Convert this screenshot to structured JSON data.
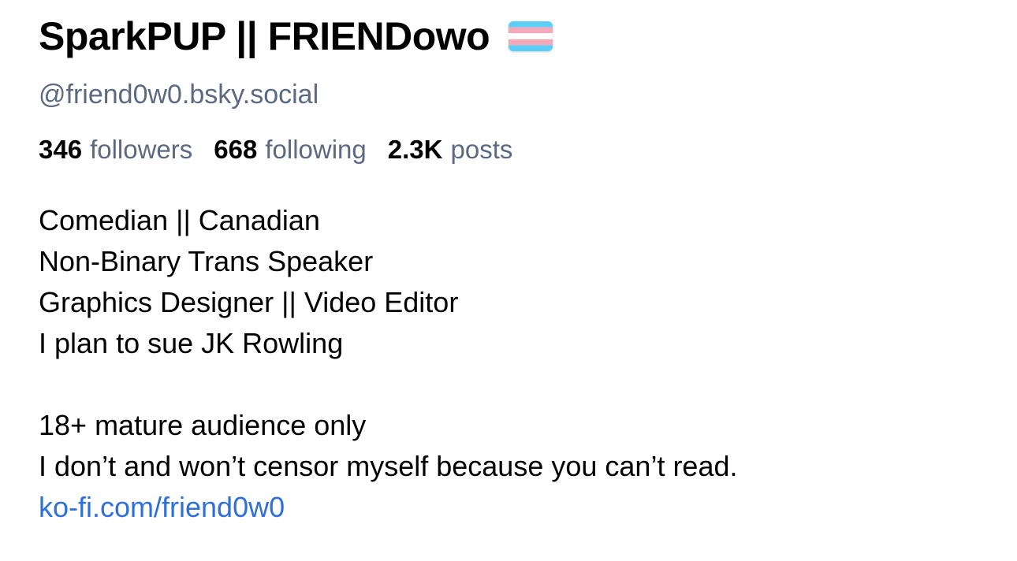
{
  "profile": {
    "display_name": "SparkPUP || FRIENDowo",
    "flag_icon": "transgender-flag-icon",
    "handle": "@friend0w0.bsky.social",
    "stats": {
      "followers_count": "346",
      "followers_label": "followers",
      "following_count": "668",
      "following_label": "following",
      "posts_count": "2.3K",
      "posts_label": "posts"
    },
    "bio": {
      "lines_1": [
        "Comedian || Canadian",
        "Non-Binary Trans Speaker",
        "Graphics Designer || Video Editor",
        "I plan to sue JK Rowling"
      ],
      "lines_2": [
        "18+ mature audience only",
        "I don’t and won’t censor myself because you can’t read."
      ],
      "link": "ko-fi.com/friend0w0"
    }
  },
  "colors": {
    "text_primary": "#000000",
    "text_secondary": "#5b6a80",
    "link": "#2f6fdc",
    "flag_blue": "#5bcefa",
    "flag_pink": "#f5a9b8",
    "flag_white": "#ffffff"
  }
}
